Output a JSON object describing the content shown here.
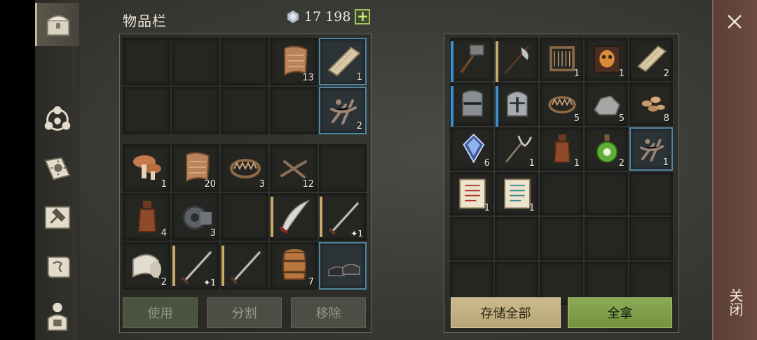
{
  "header": {
    "title": "物品栏",
    "currency_amount": "17 198",
    "currency_plus": "+"
  },
  "sidebar": {
    "items": [
      "chest-icon",
      "hub-icon",
      "recipe-book-icon",
      "hammer-card-icon",
      "scroll-icon",
      "backpack-icon"
    ],
    "active": 0
  },
  "inventory_top": [
    {
      "icon": "",
      "qty": ""
    },
    {
      "icon": "",
      "qty": ""
    },
    {
      "icon": "",
      "qty": ""
    },
    {
      "icon": "leather-icon",
      "qty": "13"
    },
    {
      "icon": "plank-icon",
      "qty": "1",
      "hl": true
    },
    {
      "icon": "",
      "qty": ""
    },
    {
      "icon": "",
      "qty": ""
    },
    {
      "icon": "",
      "qty": ""
    },
    {
      "icon": "",
      "qty": ""
    },
    {
      "icon": "bone-scrap-icon",
      "qty": "2",
      "hl": true
    }
  ],
  "inventory_bottom": [
    {
      "icon": "mushroom-icon",
      "qty": "1"
    },
    {
      "icon": "leather-icon",
      "qty": "20"
    },
    {
      "icon": "beartrap-icon",
      "qty": "3"
    },
    {
      "icon": "nails-icon",
      "qty": "12"
    },
    {
      "icon": "",
      "qty": ""
    },
    {
      "icon": "bottle-icon",
      "qty": "4"
    },
    {
      "icon": "gear-icon",
      "qty": "3"
    },
    {
      "icon": "",
      "qty": ""
    },
    {
      "icon": "scimitar-icon",
      "qty": "",
      "bar": "gold"
    },
    {
      "icon": "sword-icon",
      "qty": "1",
      "bar": "gold",
      "sub": "✦1"
    },
    {
      "icon": "cloth-roll-icon",
      "qty": "2"
    },
    {
      "icon": "sword-icon",
      "qty": "1",
      "bar": "gold",
      "sub": "✦1"
    },
    {
      "icon": "sword-icon",
      "qty": "",
      "bar": "gold"
    },
    {
      "icon": "barrel-icon",
      "qty": "7"
    },
    {
      "icon": "boots-icon",
      "qty": "",
      "hl": true
    }
  ],
  "buttons_left": {
    "use": "使用",
    "split": "分割",
    "remove": "移除"
  },
  "storage": [
    {
      "icon": "sledgehammer-icon",
      "qty": "",
      "bar": "blue"
    },
    {
      "icon": "halberd-icon",
      "qty": "",
      "bar": "gold"
    },
    {
      "icon": "loom-icon",
      "qty": "1"
    },
    {
      "icon": "mask-book-icon",
      "qty": "1"
    },
    {
      "icon": "plank-icon",
      "qty": "2"
    },
    {
      "icon": "great-helm-icon",
      "qty": "",
      "bar": "blue"
    },
    {
      "icon": "knight-helm-icon",
      "qty": "",
      "bar": "blue"
    },
    {
      "icon": "beartrap-icon",
      "qty": "5"
    },
    {
      "icon": "stone-icon",
      "qty": "5"
    },
    {
      "icon": "seeds-icon",
      "qty": "8"
    },
    {
      "icon": "crystal-icon",
      "qty": "6"
    },
    {
      "icon": "pitchfork-icon",
      "qty": "1"
    },
    {
      "icon": "bottle-icon",
      "qty": "1"
    },
    {
      "icon": "potion-icon",
      "qty": "2"
    },
    {
      "icon": "bone-scrap-icon",
      "qty": "1",
      "hl": true
    },
    {
      "icon": "red-scroll-icon",
      "qty": "1"
    },
    {
      "icon": "blue-scroll-icon",
      "qty": "1"
    },
    {
      "icon": "",
      "qty": ""
    },
    {
      "icon": "",
      "qty": ""
    },
    {
      "icon": "",
      "qty": ""
    },
    {
      "icon": "",
      "qty": ""
    },
    {
      "icon": "",
      "qty": ""
    },
    {
      "icon": "",
      "qty": ""
    },
    {
      "icon": "",
      "qty": ""
    },
    {
      "icon": "",
      "qty": ""
    },
    {
      "icon": "",
      "qty": ""
    },
    {
      "icon": "",
      "qty": ""
    },
    {
      "icon": "",
      "qty": ""
    },
    {
      "icon": "",
      "qty": ""
    },
    {
      "icon": "",
      "qty": ""
    }
  ],
  "buttons_right": {
    "store_all": "存储全部",
    "take_all": "全拿"
  },
  "close": {
    "label": "关闭"
  }
}
